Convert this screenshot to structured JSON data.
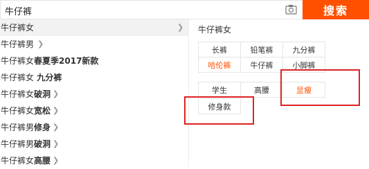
{
  "search": {
    "value": "牛仔裤",
    "button_label": "搜索"
  },
  "suggestions": [
    {
      "text": "牛仔裤女",
      "bold": ""
    },
    {
      "text": "牛仔裤男",
      "bold": ""
    },
    {
      "text": "牛仔裤女",
      "bold": "春夏季2017新款"
    },
    {
      "text": "牛仔裤女",
      "bold": " 九分裤"
    },
    {
      "text": "牛仔裤女",
      "bold": "破洞"
    },
    {
      "text": "牛仔裤女",
      "bold": "宽松"
    },
    {
      "text": "牛仔裤男",
      "bold": "修身"
    },
    {
      "text": "牛仔裤男",
      "bold": "破洞"
    },
    {
      "text": "牛仔裤女",
      "bold": "高腰"
    }
  ],
  "panel": {
    "title": "牛仔裤女",
    "tags": [
      {
        "label": "长裤",
        "highlight": false
      },
      {
        "label": "铅笔裤",
        "highlight": false
      },
      {
        "label": "九分裤",
        "highlight": false
      },
      {
        "label": "哈伦裤",
        "highlight": true
      },
      {
        "label": "牛仔裤",
        "highlight": false
      },
      {
        "label": "小脚裤",
        "highlight": false
      },
      {
        "label": "学生",
        "highlight": false
      },
      {
        "label": "高腰",
        "highlight": false
      },
      {
        "label": "显瘦",
        "highlight": true
      },
      {
        "label": "修身款",
        "highlight": false
      }
    ]
  },
  "colors": {
    "accent": "#ff5000",
    "annotation": "#dd2222"
  },
  "icons": {
    "camera": "camera-icon",
    "chevron": "chevron-right-icon"
  }
}
